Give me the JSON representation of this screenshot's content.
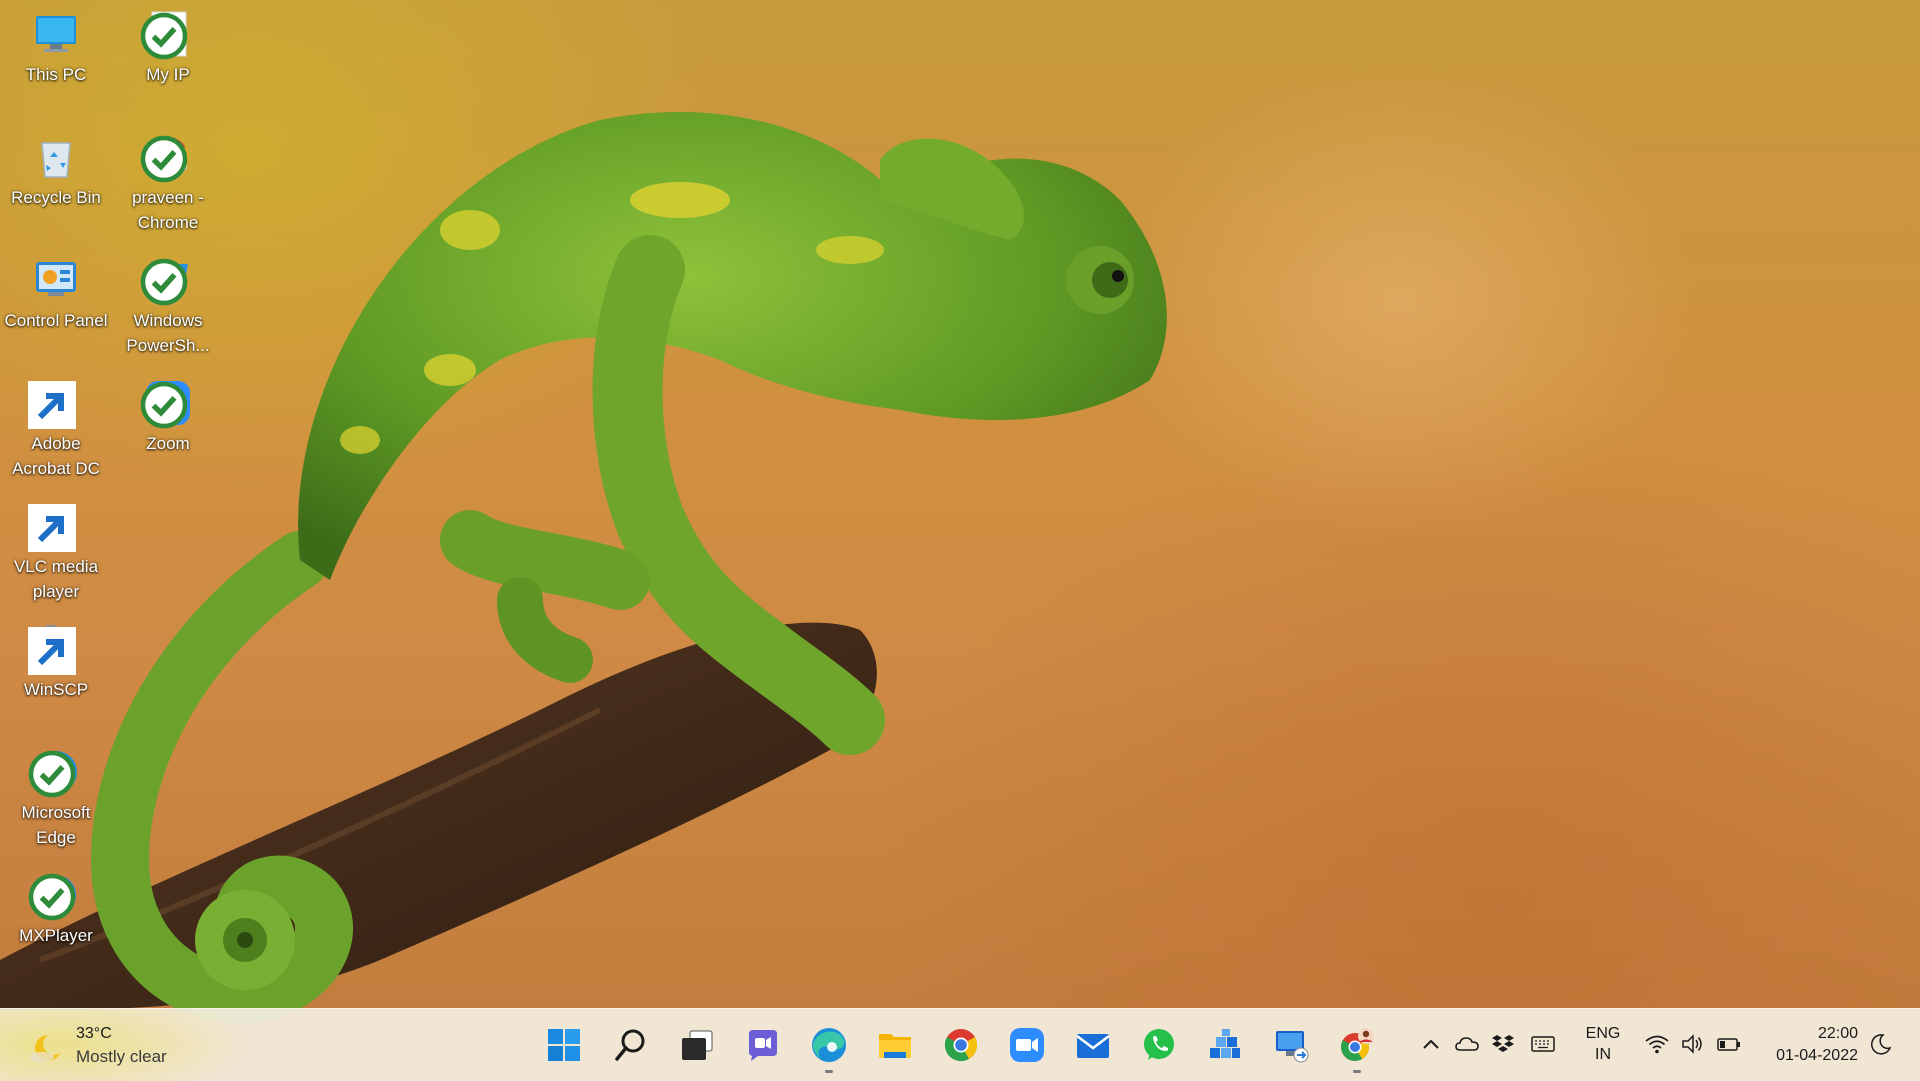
{
  "desktop": {
    "icons": [
      {
        "id": "this-pc",
        "label": "This PC",
        "icon": "monitor-icon"
      },
      {
        "id": "my-ip",
        "label": "My IP",
        "icon": "document-icon"
      },
      {
        "id": "recycle-bin",
        "label": "Recycle Bin",
        "icon": "recycle-bin-icon"
      },
      {
        "id": "praveen-chrome",
        "label": "praveen - Chrome",
        "icon": "chrome-profile-icon"
      },
      {
        "id": "control-panel",
        "label": "Control Panel",
        "icon": "control-panel-icon"
      },
      {
        "id": "windows-powershell",
        "label": "Windows PowerSh...",
        "icon": "powershell-icon"
      },
      {
        "id": "adobe-acrobat",
        "label": "Adobe Acrobat DC",
        "icon": "acrobat-icon"
      },
      {
        "id": "zoom",
        "label": "Zoom",
        "icon": "zoom-icon"
      },
      {
        "id": "vlc",
        "label": "VLC media player",
        "icon": "vlc-icon"
      },
      {
        "id": "winscp",
        "label": "WinSCP",
        "icon": "winscp-icon"
      },
      {
        "id": "edge",
        "label": "Microsoft Edge",
        "icon": "edge-icon"
      },
      {
        "id": "mxplayer",
        "label": "MXPlayer",
        "icon": "mxplayer-icon"
      }
    ]
  },
  "taskbar": {
    "weather": {
      "temp": "33°C",
      "condition": "Mostly clear",
      "icon": "moon-icon"
    },
    "apps": [
      {
        "name": "start",
        "icon": "windows-logo-icon"
      },
      {
        "name": "search",
        "icon": "search-icon"
      },
      {
        "name": "task-view",
        "icon": "task-view-icon"
      },
      {
        "name": "teams-chat",
        "icon": "teams-chat-icon"
      },
      {
        "name": "edge",
        "icon": "edge-icon",
        "running": true
      },
      {
        "name": "file-explorer",
        "icon": "folder-icon"
      },
      {
        "name": "chrome",
        "icon": "chrome-icon"
      },
      {
        "name": "zoom",
        "icon": "zoom-icon"
      },
      {
        "name": "mail",
        "icon": "mail-icon"
      },
      {
        "name": "whatsapp",
        "icon": "whatsapp-icon"
      },
      {
        "name": "blocks-app",
        "icon": "blocks-icon"
      },
      {
        "name": "remote-desktop",
        "icon": "remote-desktop-icon"
      },
      {
        "name": "chrome-profile",
        "icon": "chrome-profile-icon",
        "running": true
      }
    ],
    "tray": {
      "icons": [
        "chevron-up-icon",
        "onedrive-cloud-icon",
        "dropbox-icon",
        "keyboard-icon",
        "wifi-icon",
        "volume-icon",
        "battery-icon",
        "moon-icon"
      ],
      "language_line1": "ENG",
      "language_line2": "IN",
      "time": "22:00",
      "date": "01-04-2022"
    }
  },
  "colors": {
    "taskbar_bg": "#f4eee0",
    "wallpaper_main": "#cf8a45",
    "chameleon_green": "#6ca62a"
  }
}
